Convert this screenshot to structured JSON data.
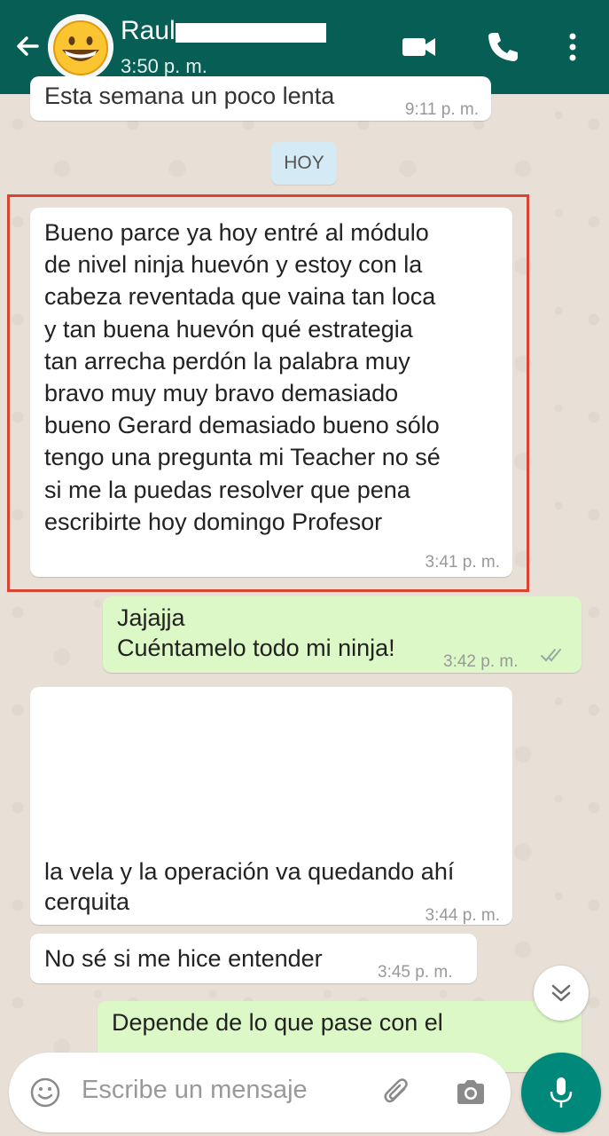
{
  "header": {
    "contact_name": "Raul",
    "status": "3:50 p. m.",
    "icons": [
      "back-arrow-icon",
      "video-call-icon",
      "phone-icon",
      "menu-icon"
    ],
    "color": "#075e54"
  },
  "messages": {
    "partial": {
      "text": "Esta semana un poco lenta",
      "time": "9:11 p. m."
    },
    "day_chip": "HOY",
    "msg1": {
      "lines": [
        "Bueno parce ya hoy entré al módulo",
        "de nivel ninja huevón y estoy con la",
        "cabeza reventada que vaina tan loca",
        "y tan buena huevón qué estrategia",
        "tan arrecha perdón la palabra muy",
        "bravo muy muy bravo demasiado",
        "bueno Gerard demasiado bueno sólo",
        "tengo una pregunta mi Teacher no sé",
        "si me la puedas resolver que pena",
        "escribirte hoy domingo Profesor"
      ],
      "time": "3:41 p. m."
    },
    "msg2": {
      "line1": "Jajajja",
      "line2": "Cuéntamelo todo mi ninja!",
      "time": "3:42 p. m."
    },
    "msg3": {
      "line1": "la vela y la operación va quedando ahí",
      "line2": "cerquita",
      "time": "3:44 p. m."
    },
    "msg4": {
      "text": "No sé si me hice entender",
      "time": "3:45 p. m."
    },
    "msg5": {
      "text": "Depende de lo que pase con el"
    }
  },
  "input": {
    "placeholder": "Escribe un mensaje",
    "icons": [
      "emoji-icon",
      "attach-icon",
      "camera-icon",
      "mic-icon"
    ]
  },
  "colors": {
    "incoming_bubble": "#ffffff",
    "outgoing_bubble": "#dcf8c6",
    "highlight": "#d9432f",
    "mic_button": "#00897b"
  }
}
